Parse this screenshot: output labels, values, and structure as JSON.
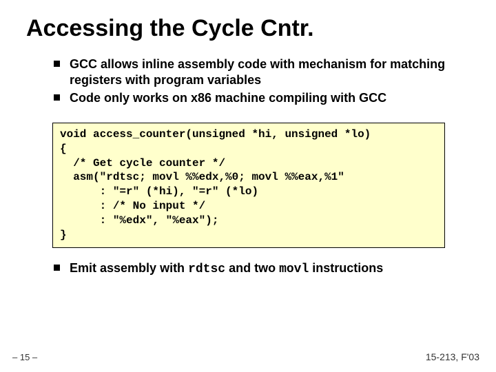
{
  "title": "Accessing the Cycle Cntr.",
  "bullets_top": [
    "GCC allows inline assembly code with mechanism for matching registers with program variables",
    "Code only works on x86 machine compiling with GCC"
  ],
  "code": "void access_counter(unsigned *hi, unsigned *lo)\n{\n  /* Get cycle counter */\n  asm(\"rdtsc; movl %%edx,%0; movl %%eax,%1\"\n      : \"=r\" (*hi), \"=r\" (*lo)\n      : /* No input */\n      : \"%edx\", \"%eax\");\n}",
  "bullet_bottom": {
    "pre": "Emit assembly with ",
    "mono1": "rdtsc",
    "mid": " and two ",
    "mono2": "movl",
    "post": " instructions"
  },
  "footer": {
    "left": "– 15 –",
    "right": "15-213, F'03"
  }
}
